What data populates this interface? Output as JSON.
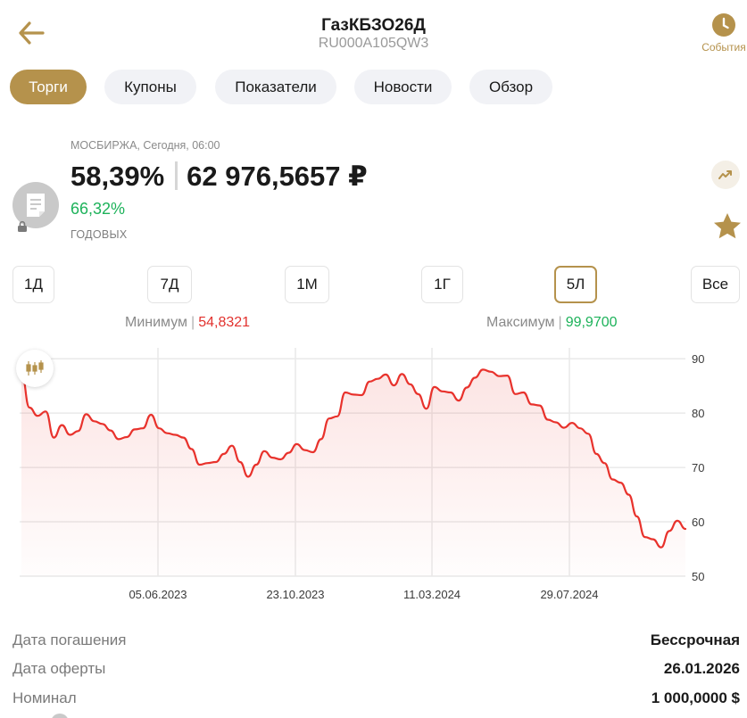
{
  "header": {
    "title": "ГазКБЗО26Д",
    "isin": "RU000A105QW3",
    "events_label": "События"
  },
  "tabs": [
    {
      "label": "Торги",
      "active": true
    },
    {
      "label": "Купоны",
      "active": false
    },
    {
      "label": "Показатели",
      "active": false
    },
    {
      "label": "Новости",
      "active": false
    },
    {
      "label": "Обзор",
      "active": false
    }
  ],
  "quote": {
    "exchange_time": "МОСБИРЖА, Сегодня, 06:00",
    "price_percent": "58,39%",
    "price_value": "62 976,5657 ₽",
    "yield": "66,32%",
    "yield_label": "ГОДОВЫХ"
  },
  "periods": [
    {
      "label": "1Д",
      "active": false
    },
    {
      "label": "7Д",
      "active": false
    },
    {
      "label": "1М",
      "active": false
    },
    {
      "label": "1Г",
      "active": false
    },
    {
      "label": "5Л",
      "active": true
    },
    {
      "label": "Все",
      "active": false
    }
  ],
  "range": {
    "min_label": "Минимум",
    "min_value": "54,8321",
    "max_label": "Максимум",
    "max_value": "99,9700"
  },
  "colors": {
    "accent": "#b5924c",
    "line": "#e8322c",
    "positive": "#1db25a",
    "negative": "#e2322e"
  },
  "icons": {
    "back": "arrow-left-icon",
    "events": "clock-icon",
    "bond": "document-icon",
    "lock": "lock-icon",
    "trend": "trend-up-icon",
    "favorite": "star-icon",
    "chart_type": "candlestick-icon"
  },
  "chart_data": {
    "type": "area",
    "x_ticks": [
      "05.06.2023",
      "23.10.2023",
      "11.03.2024",
      "29.07.2024"
    ],
    "y_ticks": [
      90,
      80,
      70,
      60,
      50
    ],
    "ylim": [
      50,
      92
    ],
    "grid": true,
    "series": [
      {
        "values": [
          87.5,
          81,
          79.5,
          80.3,
          75.5,
          77.8,
          76,
          76.7,
          79.8,
          78.5,
          78,
          76.8,
          75.2,
          75.6,
          77,
          77.2,
          79.7,
          77.2,
          76.3,
          76,
          75.5,
          73.4,
          70.5,
          70.8,
          71,
          72.5,
          74,
          71,
          68.3,
          70.5,
          73,
          71.8,
          71.5,
          72.7,
          74.3,
          73.2,
          72.8,
          75.2,
          79,
          79.4,
          83.8,
          83.4,
          83.3,
          85.8,
          86.3,
          87.1,
          85.1,
          87.2,
          85.3,
          83.5,
          80.8,
          84.8,
          84,
          83.8,
          82.3,
          84.7,
          86.5,
          88,
          87.6,
          86.8,
          86.9,
          83.5,
          83.8,
          81.6,
          81.4,
          78.8,
          78.3,
          77.3,
          78.2,
          77.2,
          76.2,
          72.5,
          70.8,
          67.8,
          67.2,
          65,
          61,
          57.2,
          56.8,
          55.3,
          58.3,
          60.2,
          58.7
        ]
      }
    ]
  },
  "details": [
    {
      "label": "Дата погашения",
      "value": "Бессрочная"
    },
    {
      "label": "Дата оферты",
      "value": "26.01.2026"
    },
    {
      "label": "Номинал",
      "value": "1 000,0000 $"
    }
  ]
}
